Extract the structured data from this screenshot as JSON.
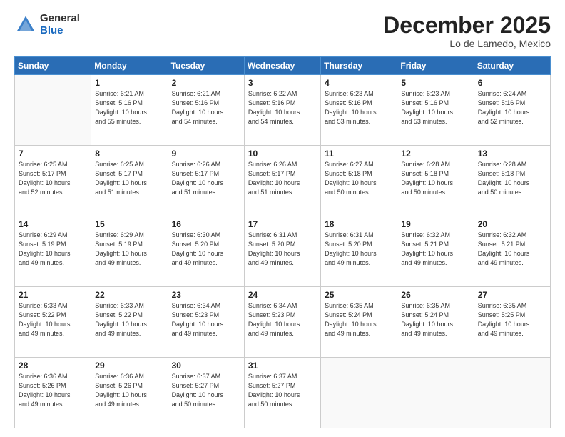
{
  "logo": {
    "general": "General",
    "blue": "Blue"
  },
  "header": {
    "month": "December 2025",
    "location": "Lo de Lamedo, Mexico"
  },
  "weekdays": [
    "Sunday",
    "Monday",
    "Tuesday",
    "Wednesday",
    "Thursday",
    "Friday",
    "Saturday"
  ],
  "weeks": [
    [
      {
        "day": "",
        "info": ""
      },
      {
        "day": "1",
        "info": "Sunrise: 6:21 AM\nSunset: 5:16 PM\nDaylight: 10 hours\nand 55 minutes."
      },
      {
        "day": "2",
        "info": "Sunrise: 6:21 AM\nSunset: 5:16 PM\nDaylight: 10 hours\nand 54 minutes."
      },
      {
        "day": "3",
        "info": "Sunrise: 6:22 AM\nSunset: 5:16 PM\nDaylight: 10 hours\nand 54 minutes."
      },
      {
        "day": "4",
        "info": "Sunrise: 6:23 AM\nSunset: 5:16 PM\nDaylight: 10 hours\nand 53 minutes."
      },
      {
        "day": "5",
        "info": "Sunrise: 6:23 AM\nSunset: 5:16 PM\nDaylight: 10 hours\nand 53 minutes."
      },
      {
        "day": "6",
        "info": "Sunrise: 6:24 AM\nSunset: 5:16 PM\nDaylight: 10 hours\nand 52 minutes."
      }
    ],
    [
      {
        "day": "7",
        "info": "Sunrise: 6:25 AM\nSunset: 5:17 PM\nDaylight: 10 hours\nand 52 minutes."
      },
      {
        "day": "8",
        "info": "Sunrise: 6:25 AM\nSunset: 5:17 PM\nDaylight: 10 hours\nand 51 minutes."
      },
      {
        "day": "9",
        "info": "Sunrise: 6:26 AM\nSunset: 5:17 PM\nDaylight: 10 hours\nand 51 minutes."
      },
      {
        "day": "10",
        "info": "Sunrise: 6:26 AM\nSunset: 5:17 PM\nDaylight: 10 hours\nand 51 minutes."
      },
      {
        "day": "11",
        "info": "Sunrise: 6:27 AM\nSunset: 5:18 PM\nDaylight: 10 hours\nand 50 minutes."
      },
      {
        "day": "12",
        "info": "Sunrise: 6:28 AM\nSunset: 5:18 PM\nDaylight: 10 hours\nand 50 minutes."
      },
      {
        "day": "13",
        "info": "Sunrise: 6:28 AM\nSunset: 5:18 PM\nDaylight: 10 hours\nand 50 minutes."
      }
    ],
    [
      {
        "day": "14",
        "info": "Sunrise: 6:29 AM\nSunset: 5:19 PM\nDaylight: 10 hours\nand 49 minutes."
      },
      {
        "day": "15",
        "info": "Sunrise: 6:29 AM\nSunset: 5:19 PM\nDaylight: 10 hours\nand 49 minutes."
      },
      {
        "day": "16",
        "info": "Sunrise: 6:30 AM\nSunset: 5:20 PM\nDaylight: 10 hours\nand 49 minutes."
      },
      {
        "day": "17",
        "info": "Sunrise: 6:31 AM\nSunset: 5:20 PM\nDaylight: 10 hours\nand 49 minutes."
      },
      {
        "day": "18",
        "info": "Sunrise: 6:31 AM\nSunset: 5:20 PM\nDaylight: 10 hours\nand 49 minutes."
      },
      {
        "day": "19",
        "info": "Sunrise: 6:32 AM\nSunset: 5:21 PM\nDaylight: 10 hours\nand 49 minutes."
      },
      {
        "day": "20",
        "info": "Sunrise: 6:32 AM\nSunset: 5:21 PM\nDaylight: 10 hours\nand 49 minutes."
      }
    ],
    [
      {
        "day": "21",
        "info": "Sunrise: 6:33 AM\nSunset: 5:22 PM\nDaylight: 10 hours\nand 49 minutes."
      },
      {
        "day": "22",
        "info": "Sunrise: 6:33 AM\nSunset: 5:22 PM\nDaylight: 10 hours\nand 49 minutes."
      },
      {
        "day": "23",
        "info": "Sunrise: 6:34 AM\nSunset: 5:23 PM\nDaylight: 10 hours\nand 49 minutes."
      },
      {
        "day": "24",
        "info": "Sunrise: 6:34 AM\nSunset: 5:23 PM\nDaylight: 10 hours\nand 49 minutes."
      },
      {
        "day": "25",
        "info": "Sunrise: 6:35 AM\nSunset: 5:24 PM\nDaylight: 10 hours\nand 49 minutes."
      },
      {
        "day": "26",
        "info": "Sunrise: 6:35 AM\nSunset: 5:24 PM\nDaylight: 10 hours\nand 49 minutes."
      },
      {
        "day": "27",
        "info": "Sunrise: 6:35 AM\nSunset: 5:25 PM\nDaylight: 10 hours\nand 49 minutes."
      }
    ],
    [
      {
        "day": "28",
        "info": "Sunrise: 6:36 AM\nSunset: 5:26 PM\nDaylight: 10 hours\nand 49 minutes."
      },
      {
        "day": "29",
        "info": "Sunrise: 6:36 AM\nSunset: 5:26 PM\nDaylight: 10 hours\nand 49 minutes."
      },
      {
        "day": "30",
        "info": "Sunrise: 6:37 AM\nSunset: 5:27 PM\nDaylight: 10 hours\nand 50 minutes."
      },
      {
        "day": "31",
        "info": "Sunrise: 6:37 AM\nSunset: 5:27 PM\nDaylight: 10 hours\nand 50 minutes."
      },
      {
        "day": "",
        "info": ""
      },
      {
        "day": "",
        "info": ""
      },
      {
        "day": "",
        "info": ""
      }
    ]
  ]
}
